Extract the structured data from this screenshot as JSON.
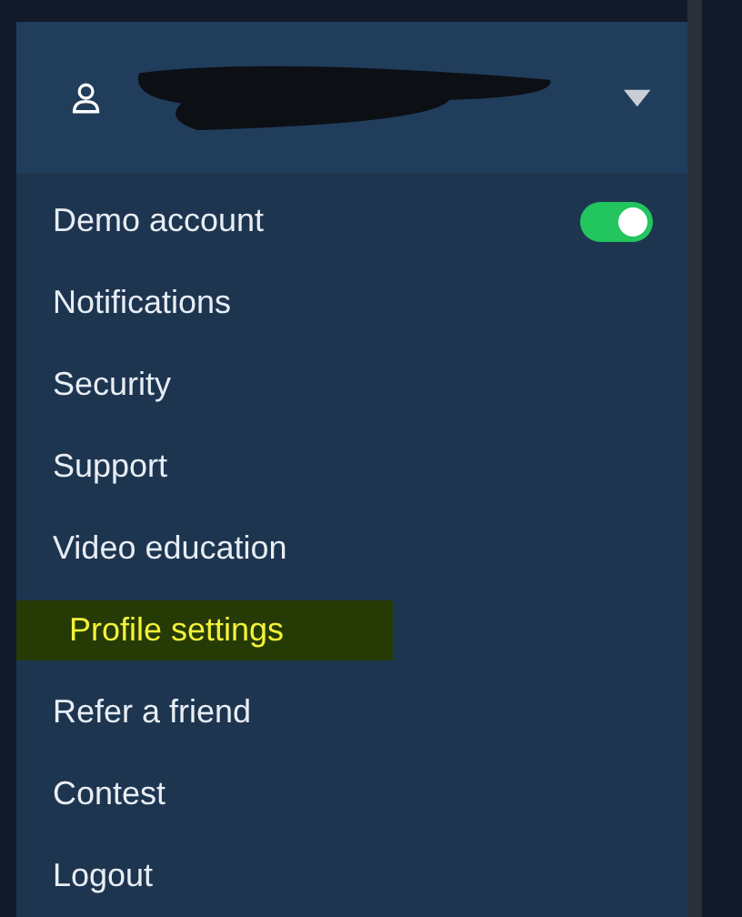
{
  "account_header": {
    "expanded": true
  },
  "menu_items": [
    {
      "kind": "toggle",
      "label": "Demo account",
      "on": true,
      "highlighted": false
    },
    {
      "kind": "link",
      "label": "Notifications",
      "highlighted": false
    },
    {
      "kind": "link",
      "label": "Security",
      "highlighted": false
    },
    {
      "kind": "link",
      "label": "Support",
      "highlighted": false
    },
    {
      "kind": "link",
      "label": "Video education",
      "highlighted": false
    },
    {
      "kind": "link",
      "label": "Profile settings",
      "highlighted": true
    },
    {
      "kind": "link",
      "label": "Refer a friend",
      "highlighted": false
    },
    {
      "kind": "link",
      "label": "Contest",
      "highlighted": false
    },
    {
      "kind": "link",
      "label": "Logout",
      "highlighted": false
    }
  ]
}
